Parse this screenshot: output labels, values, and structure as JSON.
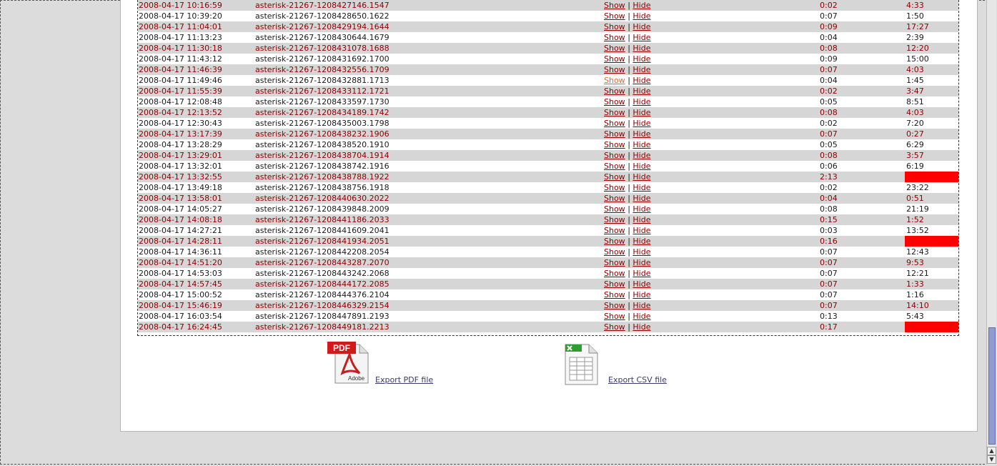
{
  "rows": [
    {
      "date": "2008-04-17 10:16:59",
      "id": "asterisk-21267-1208427146.1547",
      "show": "Show",
      "sep": "|",
      "hide": "Hide",
      "dur": "0:02",
      "bill": "4:33",
      "alert": false,
      "visited": false
    },
    {
      "date": "2008-04-17 10:39:20",
      "id": "asterisk-21267-1208428650.1622",
      "show": "Show",
      "sep": "|",
      "hide": "Hide",
      "dur": "0:07",
      "bill": "1:50",
      "alert": false,
      "visited": false
    },
    {
      "date": "2008-04-17 11:04:01",
      "id": "asterisk-21267-1208429194.1644",
      "show": "Show",
      "sep": "|",
      "hide": "Hide",
      "dur": "0:09",
      "bill": "17:27",
      "alert": false,
      "visited": false
    },
    {
      "date": "2008-04-17 11:13:23",
      "id": "asterisk-21267-1208430644.1679",
      "show": "Show",
      "sep": "|",
      "hide": "Hide",
      "dur": "0:04",
      "bill": "2:39",
      "alert": false,
      "visited": false
    },
    {
      "date": "2008-04-17 11:30:18",
      "id": "asterisk-21267-1208431078.1688",
      "show": "Show",
      "sep": "|",
      "hide": "Hide",
      "dur": "0:08",
      "bill": "12:20",
      "alert": false,
      "visited": false
    },
    {
      "date": "2008-04-17 11:43:12",
      "id": "asterisk-21267-1208431692.1700",
      "show": "Show",
      "sep": "|",
      "hide": "Hide",
      "dur": "0:09",
      "bill": "15:00",
      "alert": false,
      "visited": false
    },
    {
      "date": "2008-04-17 11:46:39",
      "id": "asterisk-21267-1208432556.1709",
      "show": "Show",
      "sep": "|",
      "hide": "Hide",
      "dur": "0:07",
      "bill": "4:03",
      "alert": false,
      "visited": false
    },
    {
      "date": "2008-04-17 11:49:46",
      "id": "asterisk-21267-1208432881.1713",
      "show": "Show",
      "sep": "|",
      "hide": "Hide",
      "dur": "0:04",
      "bill": "1:45",
      "alert": false,
      "visited": true
    },
    {
      "date": "2008-04-17 11:55:39",
      "id": "asterisk-21267-1208433112.1721",
      "show": "Show",
      "sep": "|",
      "hide": "Hide",
      "dur": "0:02",
      "bill": "3:47",
      "alert": false,
      "visited": false
    },
    {
      "date": "2008-04-17 12:08:48",
      "id": "asterisk-21267-1208433597.1730",
      "show": "Show",
      "sep": "|",
      "hide": "Hide",
      "dur": "0:05",
      "bill": "8:51",
      "alert": false,
      "visited": false
    },
    {
      "date": "2008-04-17 12:13:52",
      "id": "asterisk-21267-1208434189.1742",
      "show": "Show",
      "sep": "|",
      "hide": "Hide",
      "dur": "0:08",
      "bill": "4:03",
      "alert": false,
      "visited": false
    },
    {
      "date": "2008-04-17 12:30:43",
      "id": "asterisk-21267-1208435003.1798",
      "show": "Show",
      "sep": "|",
      "hide": "Hide",
      "dur": "0:02",
      "bill": "7:20",
      "alert": false,
      "visited": false
    },
    {
      "date": "2008-04-17 13:17:39",
      "id": "asterisk-21267-1208438232.1906",
      "show": "Show",
      "sep": "|",
      "hide": "Hide",
      "dur": "0:07",
      "bill": "0:27",
      "alert": false,
      "visited": false
    },
    {
      "date": "2008-04-17 13:28:29",
      "id": "asterisk-21267-1208438520.1910",
      "show": "Show",
      "sep": "|",
      "hide": "Hide",
      "dur": "0:05",
      "bill": "6:29",
      "alert": false,
      "visited": false
    },
    {
      "date": "2008-04-17 13:29:01",
      "id": "asterisk-21267-1208438704.1914",
      "show": "Show",
      "sep": "|",
      "hide": "Hide",
      "dur": "0:08",
      "bill": "3:57",
      "alert": false,
      "visited": false
    },
    {
      "date": "2008-04-17 13:32:01",
      "id": "asterisk-21267-1208438742.1916",
      "show": "Show",
      "sep": "|",
      "hide": "Hide",
      "dur": "0:06",
      "bill": "6:19",
      "alert": false,
      "visited": false
    },
    {
      "date": "2008-04-17 13:32:55",
      "id": "asterisk-21267-1208438788.1922",
      "show": "Show",
      "sep": "|",
      "hide": "Hide",
      "dur": "2:13",
      "bill": "",
      "alert": true,
      "visited": false
    },
    {
      "date": "2008-04-17 13:49:18",
      "id": "asterisk-21267-1208438756.1918",
      "show": "Show",
      "sep": "|",
      "hide": "Hide",
      "dur": "0:02",
      "bill": "23:22",
      "alert": false,
      "visited": false
    },
    {
      "date": "2008-04-17 13:58:01",
      "id": "asterisk-21267-1208440630.2022",
      "show": "Show",
      "sep": "|",
      "hide": "Hide",
      "dur": "0:04",
      "bill": "0:51",
      "alert": false,
      "visited": false
    },
    {
      "date": "2008-04-17 14:05:27",
      "id": "asterisk-21267-1208439848.2009",
      "show": "Show",
      "sep": "|",
      "hide": "Hide",
      "dur": "0:08",
      "bill": "21:19",
      "alert": false,
      "visited": false
    },
    {
      "date": "2008-04-17 14:08:18",
      "id": "asterisk-21267-1208441186.2033",
      "show": "Show",
      "sep": "|",
      "hide": "Hide",
      "dur": "0:15",
      "bill": "1:52",
      "alert": false,
      "visited": false
    },
    {
      "date": "2008-04-17 14:27:21",
      "id": "asterisk-21267-1208441609.2041",
      "show": "Show",
      "sep": "|",
      "hide": "Hide",
      "dur": "0:03",
      "bill": "13:52",
      "alert": false,
      "visited": false
    },
    {
      "date": "2008-04-17 14:28:11",
      "id": "asterisk-21267-1208441934.2051",
      "show": "Show",
      "sep": "|",
      "hide": "Hide",
      "dur": "0:16",
      "bill": "",
      "alert": true,
      "visited": false
    },
    {
      "date": "2008-04-17 14:36:11",
      "id": "asterisk-21267-1208442208.2054",
      "show": "Show",
      "sep": "|",
      "hide": "Hide",
      "dur": "0:07",
      "bill": "12:43",
      "alert": false,
      "visited": false
    },
    {
      "date": "2008-04-17 14:51:20",
      "id": "asterisk-21267-1208443287.2070",
      "show": "Show",
      "sep": "|",
      "hide": "Hide",
      "dur": "0:07",
      "bill": "9:53",
      "alert": false,
      "visited": false
    },
    {
      "date": "2008-04-17 14:53:03",
      "id": "asterisk-21267-1208443242.2068",
      "show": "Show",
      "sep": "|",
      "hide": "Hide",
      "dur": "0:07",
      "bill": "12:21",
      "alert": false,
      "visited": false
    },
    {
      "date": "2008-04-17 14:57:45",
      "id": "asterisk-21267-1208444172.2085",
      "show": "Show",
      "sep": "|",
      "hide": "Hide",
      "dur": "0:07",
      "bill": "1:33",
      "alert": false,
      "visited": false
    },
    {
      "date": "2008-04-17 15:00:52",
      "id": "asterisk-21267-1208444376.2104",
      "show": "Show",
      "sep": "|",
      "hide": "Hide",
      "dur": "0:07",
      "bill": "1:16",
      "alert": false,
      "visited": false
    },
    {
      "date": "2008-04-17 15:46:19",
      "id": "asterisk-21267-1208446329.2154",
      "show": "Show",
      "sep": "|",
      "hide": "Hide",
      "dur": "0:07",
      "bill": "14:10",
      "alert": false,
      "visited": false
    },
    {
      "date": "2008-04-17 16:03:54",
      "id": "asterisk-21267-1208447891.2193",
      "show": "Show",
      "sep": "|",
      "hide": "Hide",
      "dur": "0:13",
      "bill": "5:43",
      "alert": false,
      "visited": false
    },
    {
      "date": "2008-04-17 16:24:45",
      "id": "asterisk-21267-1208449181.2213",
      "show": "Show",
      "sep": "|",
      "hide": "Hide",
      "dur": "0:17",
      "bill": "",
      "alert": true,
      "visited": false
    }
  ],
  "export": {
    "pdf_badge": "PDF",
    "pdf_brand": "Adobe",
    "pdf_label": "Export PDF file",
    "csv_label": "Export CSV file",
    "pdf_icon": "pdf-file-icon",
    "csv_icon": "spreadsheet-file-icon"
  },
  "colors": {
    "row_text_odd": "#8b0000",
    "row_bg_odd": "#d6d6d6",
    "alert": "#ff0000",
    "visited_link": "#d0703c",
    "scroll_thumb": "#8f9bd1"
  }
}
